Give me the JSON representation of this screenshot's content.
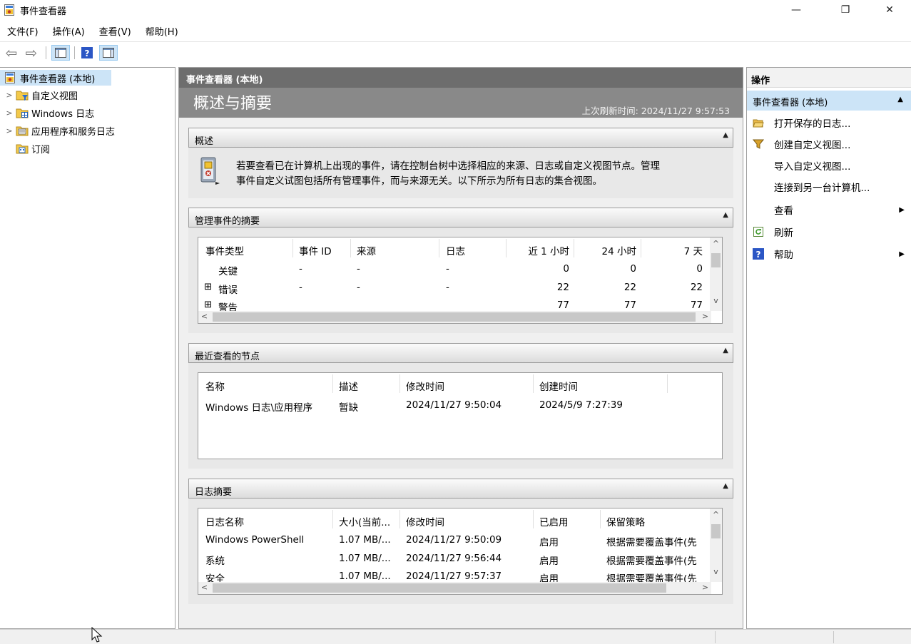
{
  "window": {
    "title": "事件查看器",
    "controls": {
      "minimize": "—",
      "maximize": "❐",
      "close": "✕"
    }
  },
  "menu": [
    "文件(F)",
    "操作(A)",
    "查看(V)",
    "帮助(H)"
  ],
  "toolbar": {
    "back": "⇦",
    "forward": "⇨",
    "icons": [
      "back-icon",
      "forward-icon",
      "show-hide-tree-icon",
      "help-icon",
      "show-hide-action-pane-icon"
    ]
  },
  "tree": [
    {
      "label": "事件查看器 (本地)",
      "icon": "event-viewer-icon",
      "selected": true
    },
    {
      "label": "自定义视图",
      "icon": "custom-views-icon"
    },
    {
      "label": "Windows 日志",
      "icon": "windows-logs-icon"
    },
    {
      "label": "应用程序和服务日志",
      "icon": "app-service-logs-icon"
    },
    {
      "label": "订阅",
      "icon": "subscriptions-icon"
    }
  ],
  "center": {
    "header": "事件查看器 (本地)",
    "banner_title": "概述与摘要",
    "refresh_label": "上次刷新时间: 2024/11/27 9:57:53",
    "overview": {
      "title": "概述",
      "text_line1": "若要查看已在计算机上出现的事件，请在控制台树中选择相应的来源、日志或自定义视图节点。管理",
      "text_line2": "事件自定义试图包括所有管理事件，而与来源无关。以下所示为所有日志的集合视图。"
    },
    "admin_summary": {
      "title": "管理事件的摘要",
      "columns": [
        "事件类型",
        "事件 ID",
        "来源",
        "日志",
        "近 1 小时",
        "24 小时",
        "7 天"
      ],
      "rows": [
        {
          "expander": "",
          "type": "关键",
          "id": "-",
          "source": "-",
          "log": "-",
          "h1": "0",
          "h24": "0",
          "d7": "0"
        },
        {
          "expander": "⊞",
          "type": "错误",
          "id": "-",
          "source": "-",
          "log": "-",
          "h1": "22",
          "h24": "22",
          "d7": "22"
        },
        {
          "expander": "⊞",
          "type": "警告",
          "id": "",
          "source": "",
          "log": "",
          "h1": "77",
          "h24": "77",
          "d7": "77"
        }
      ]
    },
    "recent_nodes": {
      "title": "最近查看的节点",
      "columns": [
        "名称",
        "描述",
        "修改时间",
        "创建时间"
      ],
      "rows": [
        {
          "name": "Windows 日志\\应用程序",
          "desc": "暂缺",
          "modified": "2024/11/27 9:50:04",
          "created": "2024/5/9 7:27:39"
        }
      ]
    },
    "log_summary": {
      "title": "日志摘要",
      "columns": [
        "日志名称",
        "大小(当前...",
        "修改时间",
        "已启用",
        "保留策略"
      ],
      "rows": [
        {
          "name": "Windows PowerShell",
          "size": "1.07 MB/...",
          "modified": "2024/11/27 9:50:09",
          "enabled": "启用",
          "policy": "根据需要覆盖事件(先"
        },
        {
          "name": "系统",
          "size": "1.07 MB/...",
          "modified": "2024/11/27 9:56:44",
          "enabled": "启用",
          "policy": "根据需要覆盖事件(先"
        },
        {
          "name": "安全",
          "size": "1.07 MB/...",
          "modified": "2024/11/27 9:57:37",
          "enabled": "启用",
          "policy": "根据需要覆盖事件(先"
        }
      ]
    }
  },
  "actions": {
    "header": "操作",
    "group": "事件查看器 (本地)",
    "items": [
      {
        "label": "打开保存的日志...",
        "icon": "open-folder-icon",
        "submenu": false
      },
      {
        "label": "创建自定义视图...",
        "icon": "filter-icon",
        "submenu": false
      },
      {
        "label": "导入自定义视图...",
        "icon": "",
        "submenu": false
      },
      {
        "label": "连接到另一台计算机...",
        "icon": "",
        "submenu": false
      },
      {
        "label": "查看",
        "icon": "",
        "submenu": true
      },
      {
        "label": "刷新",
        "icon": "refresh-icon",
        "submenu": false
      },
      {
        "label": "帮助",
        "icon": "help-icon",
        "submenu": true
      }
    ]
  },
  "colors": {
    "selection": "#cce4f7",
    "center_header": "#6d6d6d",
    "banner": "#898989",
    "panel_bg": "#f0f0f0"
  }
}
